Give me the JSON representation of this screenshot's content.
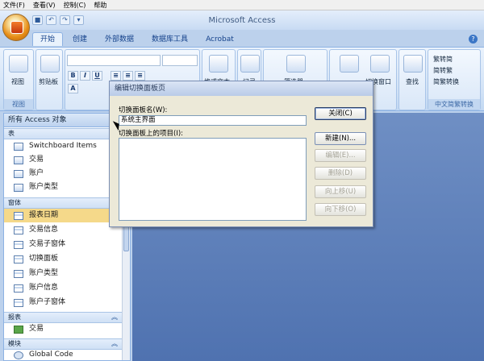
{
  "host_menu": [
    "文件(F)",
    "查看(V)",
    "控制(C)",
    "帮助"
  ],
  "app": {
    "title": "Microsoft Access"
  },
  "tabs": [
    "开始",
    "创建",
    "外部数据",
    "数据库工具",
    "Acrobat"
  ],
  "ribbon": {
    "view_label": "视图",
    "view_group": "视图",
    "clipboard_label": "剪贴板",
    "rich_text_label": "格式文本",
    "records_label": "记录",
    "filter_label": "筛选器",
    "switch_windows_label": "切换窗口",
    "find_label": "查找",
    "conv_items": [
      "繁转简",
      "简转繁",
      "简繁转换"
    ],
    "chinese_group": "中文简繁转换",
    "toolbar_symbols": [
      "B",
      "I",
      "U",
      "A"
    ]
  },
  "nav": {
    "title": "所有 Access 对象",
    "sections": [
      {
        "name": "表",
        "items": [
          "Switchboard Items",
          "交易",
          "账户",
          "账户类型"
        ]
      },
      {
        "name": "窗体",
        "items": [
          "报表日期",
          "交易信息",
          "交易子窗体",
          "切换面板",
          "账户类型",
          "账户信息",
          "账户子窗体"
        ]
      },
      {
        "name": "报表",
        "items": [
          "交易"
        ]
      },
      {
        "name": "模块",
        "items": [
          "Global Code"
        ]
      }
    ]
  },
  "dialog": {
    "title": "编辑切换面板页",
    "name_label": "切换面板名(W):",
    "name_value": "系统主界面",
    "items_label": "切换面板上的项目(I):",
    "buttons": [
      "关闭(C)",
      "新建(N)...",
      "编辑(E)...",
      "删除(D)",
      "向上移(U)",
      "向下移(O)"
    ]
  }
}
